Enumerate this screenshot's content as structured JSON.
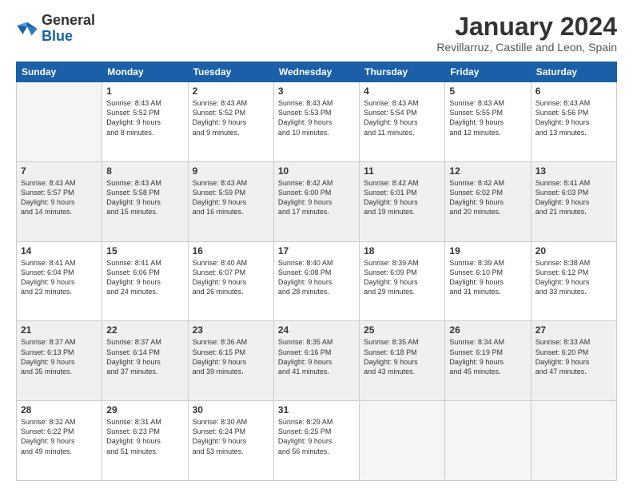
{
  "logo": {
    "line1": "General",
    "line2": "Blue"
  },
  "title": "January 2024",
  "subtitle": "Revillarruz, Castille and Leon, Spain",
  "days_header": [
    "Sunday",
    "Monday",
    "Tuesday",
    "Wednesday",
    "Thursday",
    "Friday",
    "Saturday"
  ],
  "weeks": [
    [
      {
        "num": "",
        "info": "",
        "empty": true
      },
      {
        "num": "1",
        "info": "Sunrise: 8:43 AM\nSunset: 5:52 PM\nDaylight: 9 hours\nand 8 minutes."
      },
      {
        "num": "2",
        "info": "Sunrise: 8:43 AM\nSunset: 5:52 PM\nDaylight: 9 hours\nand 9 minutes."
      },
      {
        "num": "3",
        "info": "Sunrise: 8:43 AM\nSunset: 5:53 PM\nDaylight: 9 hours\nand 10 minutes."
      },
      {
        "num": "4",
        "info": "Sunrise: 8:43 AM\nSunset: 5:54 PM\nDaylight: 9 hours\nand 11 minutes."
      },
      {
        "num": "5",
        "info": "Sunrise: 8:43 AM\nSunset: 5:55 PM\nDaylight: 9 hours\nand 12 minutes."
      },
      {
        "num": "6",
        "info": "Sunrise: 8:43 AM\nSunset: 5:56 PM\nDaylight: 9 hours\nand 13 minutes."
      }
    ],
    [
      {
        "num": "7",
        "info": "Sunrise: 8:43 AM\nSunset: 5:57 PM\nDaylight: 9 hours\nand 14 minutes."
      },
      {
        "num": "8",
        "info": "Sunrise: 8:43 AM\nSunset: 5:58 PM\nDaylight: 9 hours\nand 15 minutes."
      },
      {
        "num": "9",
        "info": "Sunrise: 8:43 AM\nSunset: 5:59 PM\nDaylight: 9 hours\nand 16 minutes."
      },
      {
        "num": "10",
        "info": "Sunrise: 8:42 AM\nSunset: 6:00 PM\nDaylight: 9 hours\nand 17 minutes."
      },
      {
        "num": "11",
        "info": "Sunrise: 8:42 AM\nSunset: 6:01 PM\nDaylight: 9 hours\nand 19 minutes."
      },
      {
        "num": "12",
        "info": "Sunrise: 8:42 AM\nSunset: 6:02 PM\nDaylight: 9 hours\nand 20 minutes."
      },
      {
        "num": "13",
        "info": "Sunrise: 8:41 AM\nSunset: 6:03 PM\nDaylight: 9 hours\nand 21 minutes."
      }
    ],
    [
      {
        "num": "14",
        "info": "Sunrise: 8:41 AM\nSunset: 6:04 PM\nDaylight: 9 hours\nand 23 minutes."
      },
      {
        "num": "15",
        "info": "Sunrise: 8:41 AM\nSunset: 6:06 PM\nDaylight: 9 hours\nand 24 minutes."
      },
      {
        "num": "16",
        "info": "Sunrise: 8:40 AM\nSunset: 6:07 PM\nDaylight: 9 hours\nand 26 minutes."
      },
      {
        "num": "17",
        "info": "Sunrise: 8:40 AM\nSunset: 6:08 PM\nDaylight: 9 hours\nand 28 minutes."
      },
      {
        "num": "18",
        "info": "Sunrise: 8:39 AM\nSunset: 6:09 PM\nDaylight: 9 hours\nand 29 minutes."
      },
      {
        "num": "19",
        "info": "Sunrise: 8:39 AM\nSunset: 6:10 PM\nDaylight: 9 hours\nand 31 minutes."
      },
      {
        "num": "20",
        "info": "Sunrise: 8:38 AM\nSunset: 6:12 PM\nDaylight: 9 hours\nand 33 minutes."
      }
    ],
    [
      {
        "num": "21",
        "info": "Sunrise: 8:37 AM\nSunset: 6:13 PM\nDaylight: 9 hours\nand 35 minutes."
      },
      {
        "num": "22",
        "info": "Sunrise: 8:37 AM\nSunset: 6:14 PM\nDaylight: 9 hours\nand 37 minutes."
      },
      {
        "num": "23",
        "info": "Sunrise: 8:36 AM\nSunset: 6:15 PM\nDaylight: 9 hours\nand 39 minutes."
      },
      {
        "num": "24",
        "info": "Sunrise: 8:35 AM\nSunset: 6:16 PM\nDaylight: 9 hours\nand 41 minutes."
      },
      {
        "num": "25",
        "info": "Sunrise: 8:35 AM\nSunset: 6:18 PM\nDaylight: 9 hours\nand 43 minutes."
      },
      {
        "num": "26",
        "info": "Sunrise: 8:34 AM\nSunset: 6:19 PM\nDaylight: 9 hours\nand 45 minutes."
      },
      {
        "num": "27",
        "info": "Sunrise: 8:33 AM\nSunset: 6:20 PM\nDaylight: 9 hours\nand 47 minutes."
      }
    ],
    [
      {
        "num": "28",
        "info": "Sunrise: 8:32 AM\nSunset: 6:22 PM\nDaylight: 9 hours\nand 49 minutes."
      },
      {
        "num": "29",
        "info": "Sunrise: 8:31 AM\nSunset: 6:23 PM\nDaylight: 9 hours\nand 51 minutes."
      },
      {
        "num": "30",
        "info": "Sunrise: 8:30 AM\nSunset: 6:24 PM\nDaylight: 9 hours\nand 53 minutes."
      },
      {
        "num": "31",
        "info": "Sunrise: 8:29 AM\nSunset: 6:25 PM\nDaylight: 9 hours\nand 56 minutes."
      },
      {
        "num": "",
        "info": "",
        "empty": true
      },
      {
        "num": "",
        "info": "",
        "empty": true
      },
      {
        "num": "",
        "info": "",
        "empty": true
      }
    ]
  ]
}
